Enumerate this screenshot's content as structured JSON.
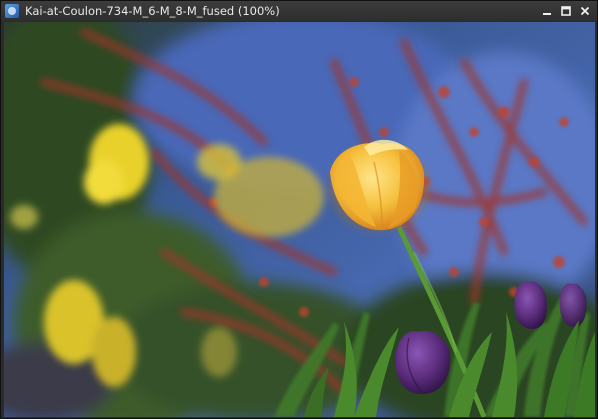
{
  "window": {
    "title": "Kai-at-Coulon-734-M_6-M_8-M_fused (100%)",
    "icons": {
      "app": "image-viewer-app-icon",
      "minimize": "minimize-icon",
      "maximize": "maximize-icon",
      "close": "close-icon"
    }
  },
  "colors": {
    "titlebar": "#333333",
    "title_text": "#e8e8e8",
    "sky_blue": "#3b5ea0",
    "tulip_yellow": "#f4c044",
    "tulip_purple": "#5a2b7a",
    "foliage_green": "#3f6a2a",
    "branch_red": "#8a2e26"
  }
}
